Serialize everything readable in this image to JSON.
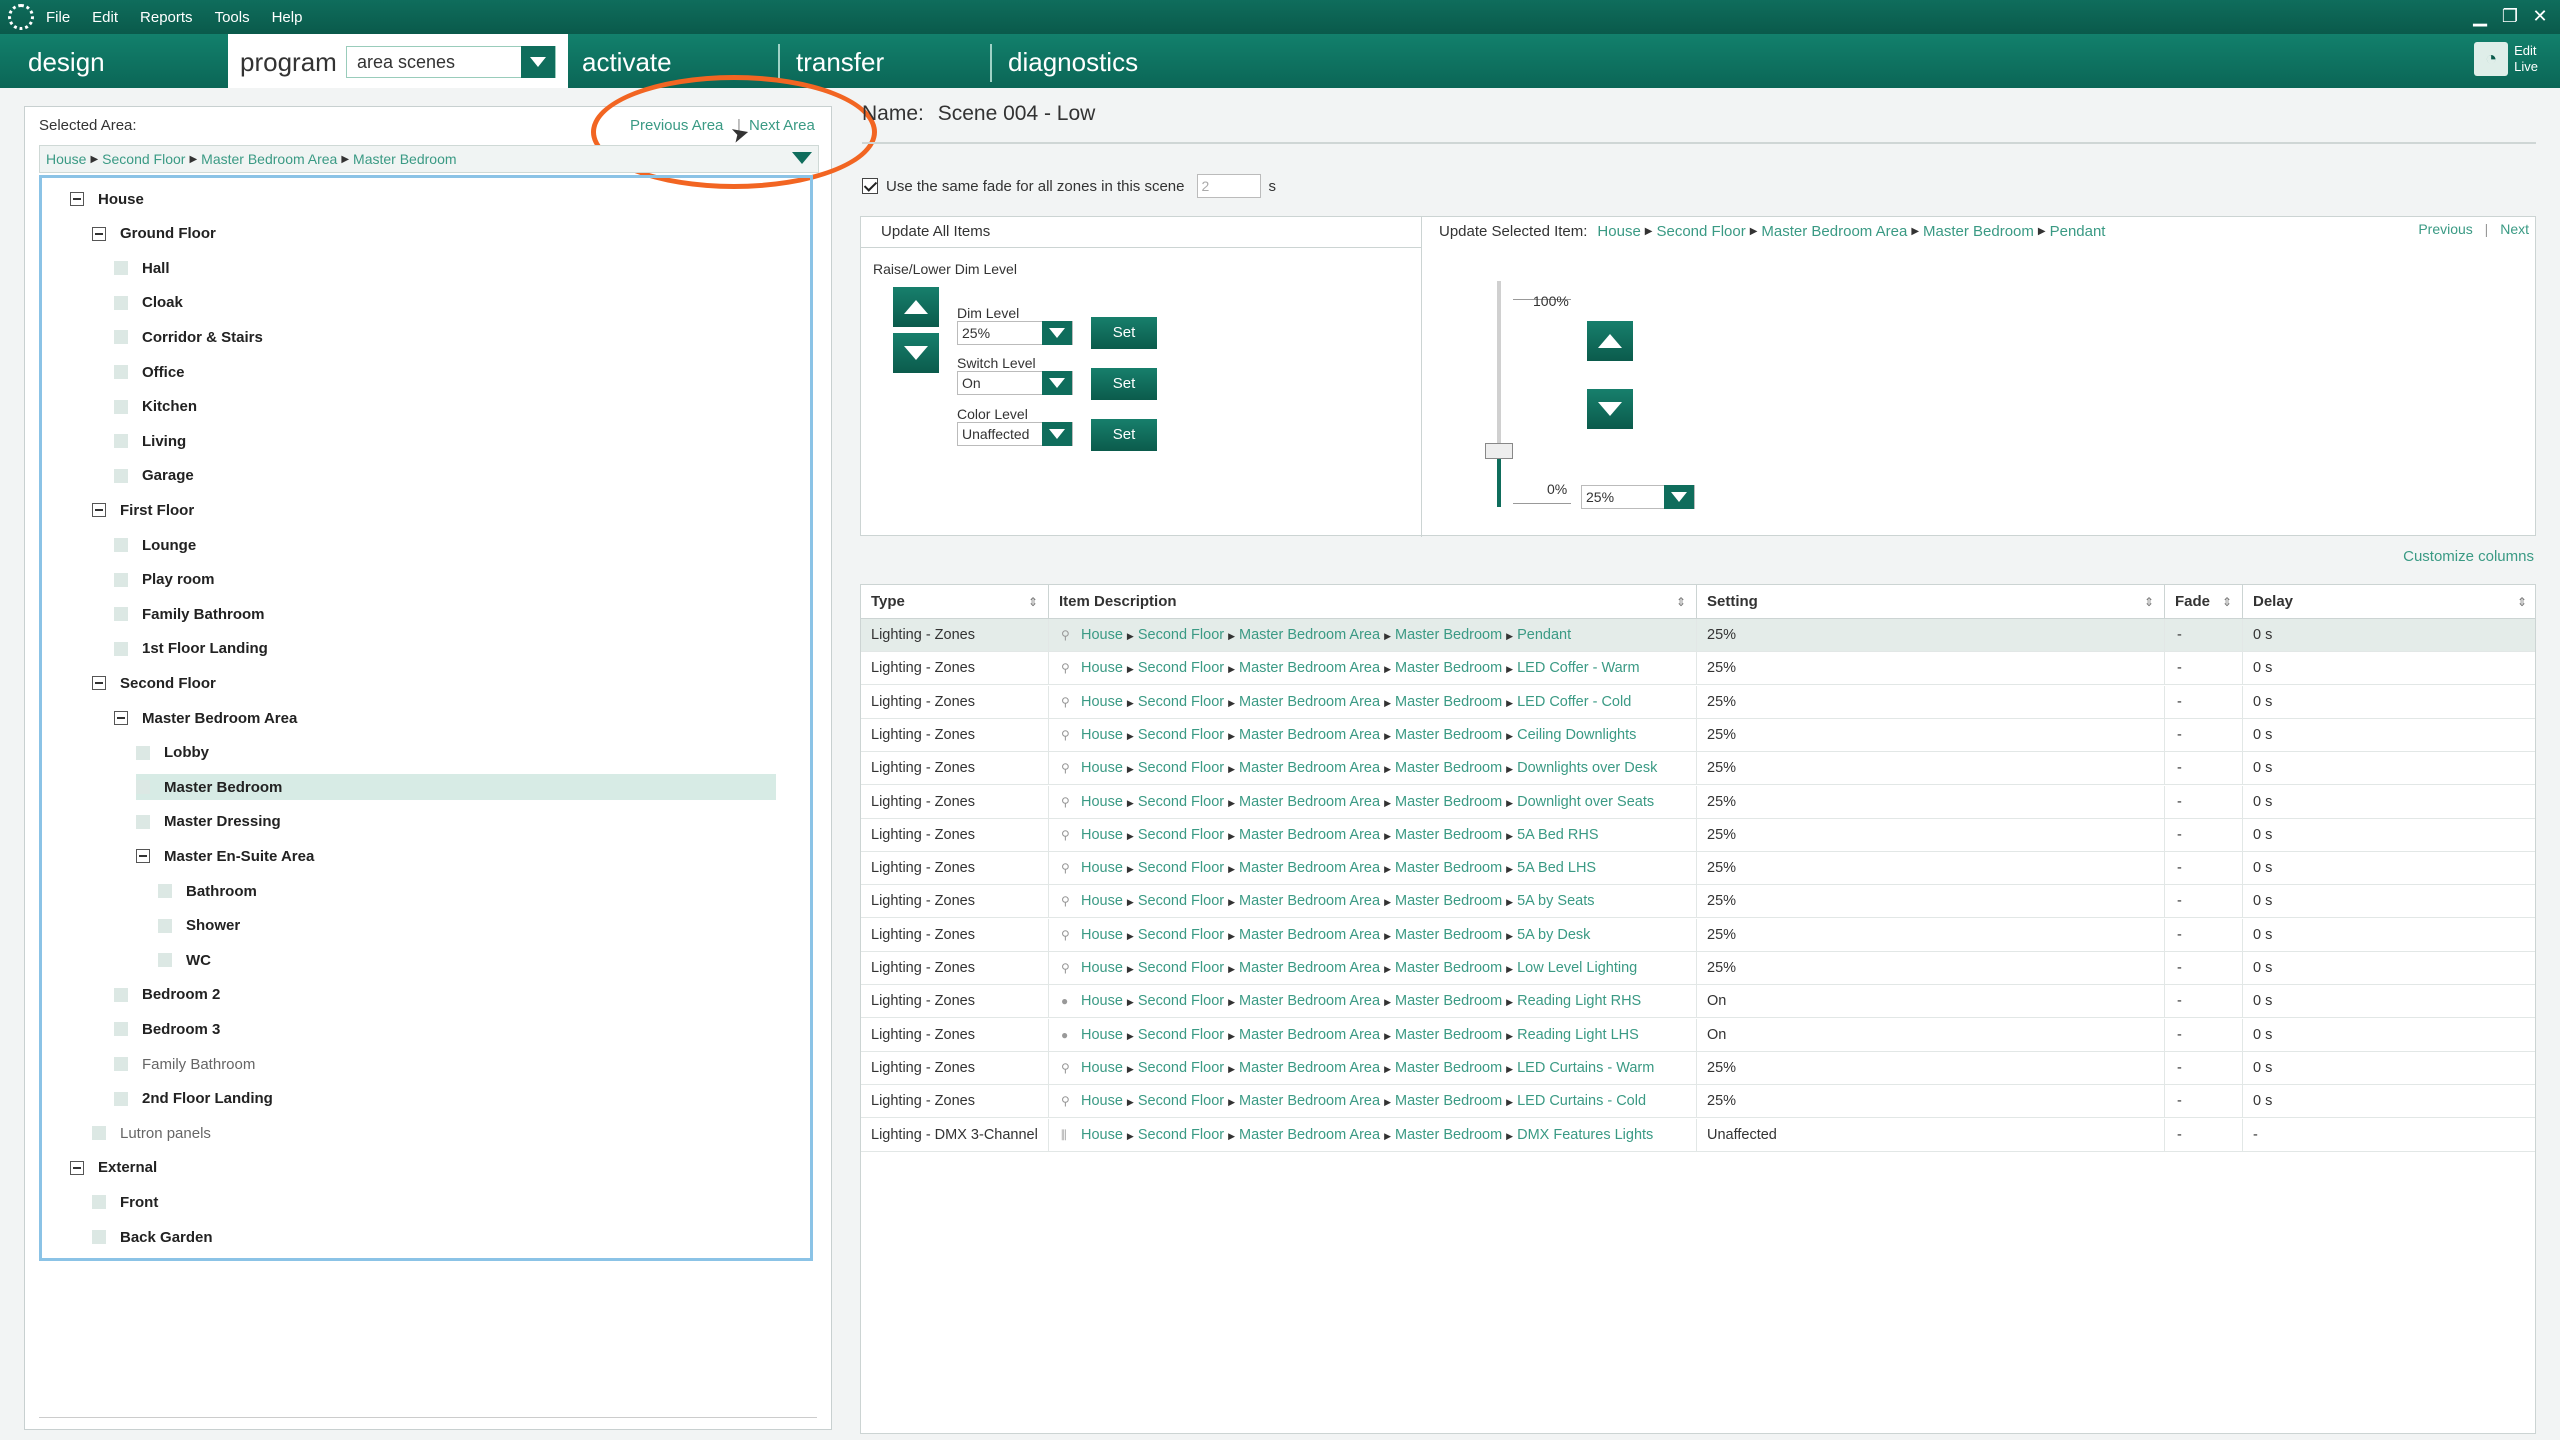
{
  "menubar": {
    "items": [
      "File",
      "Edit",
      "Reports",
      "Tools",
      "Help"
    ]
  },
  "tabs": {
    "design": "design",
    "program": "program",
    "scene_select": "area scenes",
    "activate": "activate",
    "transfer": "transfer",
    "diagnostics": "diagnostics",
    "edit_live": "Edit",
    "edit_live2": "Live"
  },
  "left": {
    "selected_area_label": "Selected Area:",
    "previous_area": "Previous Area",
    "sep": "|",
    "next_area": "Next Area",
    "breadcrumb": [
      "House",
      "Second Floor",
      "Master Bedroom Area",
      "Master Bedroom"
    ],
    "tree": [
      {
        "label": "House",
        "level": 0,
        "expanded": true
      },
      {
        "label": "Ground Floor",
        "level": 1,
        "expanded": true
      },
      {
        "label": "Hall",
        "level": 2
      },
      {
        "label": "Cloak",
        "level": 2
      },
      {
        "label": "Corridor & Stairs",
        "level": 2
      },
      {
        "label": "Office",
        "level": 2
      },
      {
        "label": "Kitchen",
        "level": 2
      },
      {
        "label": "Living",
        "level": 2
      },
      {
        "label": "Garage",
        "level": 2
      },
      {
        "label": "First Floor",
        "level": 1,
        "expanded": true
      },
      {
        "label": "Lounge",
        "level": 2
      },
      {
        "label": "Play room",
        "level": 2
      },
      {
        "label": "Family Bathroom",
        "level": 2
      },
      {
        "label": "1st Floor Landing",
        "level": 2
      },
      {
        "label": "Second Floor",
        "level": 1,
        "expanded": true
      },
      {
        "label": "Master Bedroom Area",
        "level": 2,
        "expanded": true
      },
      {
        "label": "Lobby",
        "level": 3
      },
      {
        "label": "Master Bedroom",
        "level": 3,
        "selected": true
      },
      {
        "label": "Master Dressing",
        "level": 3
      },
      {
        "label": "Master En-Suite Area",
        "level": 3,
        "expanded": true
      },
      {
        "label": "Bathroom",
        "level": 4
      },
      {
        "label": "Shower",
        "level": 4
      },
      {
        "label": "WC",
        "level": 4
      },
      {
        "label": "Bedroom 2",
        "level": 2
      },
      {
        "label": "Bedroom 3",
        "level": 2
      },
      {
        "label": "Family Bathroom",
        "level": 2,
        "light": true
      },
      {
        "label": "2nd Floor Landing",
        "level": 2
      },
      {
        "label": "Lutron panels",
        "level": 1,
        "light": true
      },
      {
        "label": "External",
        "level": 0,
        "expanded": true
      },
      {
        "label": "Front",
        "level": 1
      },
      {
        "label": "Back Garden",
        "level": 1
      }
    ]
  },
  "scene": {
    "name_label": "Name:",
    "name_value": "Scene 004 - Low",
    "same_fade_label": "Use the same fade for all zones in this scene",
    "fade_value": "2",
    "fade_unit": "s"
  },
  "update_all": {
    "title": "Update All Items",
    "raise_lower": "Raise/Lower Dim Level",
    "dim_level_label": "Dim Level",
    "dim_level_value": "25%",
    "switch_level_label": "Switch Level",
    "switch_level_value": "On",
    "color_level_label": "Color Level",
    "color_level_value": "Unaffected",
    "set_label": "Set"
  },
  "update_selected": {
    "title": "Update Selected Item:",
    "breadcrumb": [
      "House",
      "Second Floor",
      "Master Bedroom Area",
      "Master Bedroom",
      "Pendant"
    ],
    "previous": "Previous",
    "next": "Next",
    "pct_top": "100%",
    "pct_bottom": "0%",
    "level_value": "25%",
    "level_fraction": 0.25
  },
  "customize_columns": "Customize columns",
  "table": {
    "columns": [
      "Type",
      "Item Description",
      "Setting",
      "Fade",
      "Delay"
    ],
    "path": [
      "House",
      "Second Floor",
      "Master Bedroom Area",
      "Master Bedroom"
    ],
    "rows": [
      {
        "type": "Lighting - Zones",
        "item": "Pendant",
        "setting": "25%",
        "fade": "-",
        "delay": "0 s",
        "icon": "dimmer"
      },
      {
        "type": "Lighting - Zones",
        "item": "LED  Coffer - Warm",
        "setting": "25%",
        "fade": "-",
        "delay": "0 s",
        "icon": "dimmer"
      },
      {
        "type": "Lighting - Zones",
        "item": "LED  Coffer - Cold",
        "setting": "25%",
        "fade": "-",
        "delay": "0 s",
        "icon": "dimmer"
      },
      {
        "type": "Lighting - Zones",
        "item": "Ceiling Downlights",
        "setting": "25%",
        "fade": "-",
        "delay": "0 s",
        "icon": "dimmer"
      },
      {
        "type": "Lighting - Zones",
        "item": "Downlights over Desk",
        "setting": "25%",
        "fade": "-",
        "delay": "0 s",
        "icon": "dimmer"
      },
      {
        "type": "Lighting - Zones",
        "item": "Downlight over Seats",
        "setting": "25%",
        "fade": "-",
        "delay": "0 s",
        "icon": "dimmer"
      },
      {
        "type": "Lighting - Zones",
        "item": "5A Bed RHS",
        "setting": "25%",
        "fade": "-",
        "delay": "0 s",
        "icon": "dimmer"
      },
      {
        "type": "Lighting - Zones",
        "item": "5A Bed LHS",
        "setting": "25%",
        "fade": "-",
        "delay": "0 s",
        "icon": "dimmer"
      },
      {
        "type": "Lighting - Zones",
        "item": "5A by Seats",
        "setting": "25%",
        "fade": "-",
        "delay": "0 s",
        "icon": "dimmer"
      },
      {
        "type": "Lighting - Zones",
        "item": "5A by Desk",
        "setting": "25%",
        "fade": "-",
        "delay": "0 s",
        "icon": "dimmer"
      },
      {
        "type": "Lighting - Zones",
        "item": "Low Level Lighting",
        "setting": "25%",
        "fade": "-",
        "delay": "0 s",
        "icon": "dimmer"
      },
      {
        "type": "Lighting - Zones",
        "item": "Reading Light RHS",
        "setting": "On",
        "fade": "-",
        "delay": "0 s",
        "icon": "switch"
      },
      {
        "type": "Lighting - Zones",
        "item": "Reading Light LHS",
        "setting": "On",
        "fade": "-",
        "delay": "0 s",
        "icon": "switch"
      },
      {
        "type": "Lighting - Zones",
        "item": "LED Curtains - Warm",
        "setting": "25%",
        "fade": "-",
        "delay": "0 s",
        "icon": "dimmer"
      },
      {
        "type": "Lighting - Zones",
        "item": "LED Curtains - Cold",
        "setting": "25%",
        "fade": "-",
        "delay": "0 s",
        "icon": "dimmer"
      },
      {
        "type": "Lighting - DMX 3-Channel",
        "item": "DMX Features Lights",
        "setting": "Unaffected",
        "fade": "-",
        "delay": "-",
        "icon": "dmx"
      }
    ]
  }
}
